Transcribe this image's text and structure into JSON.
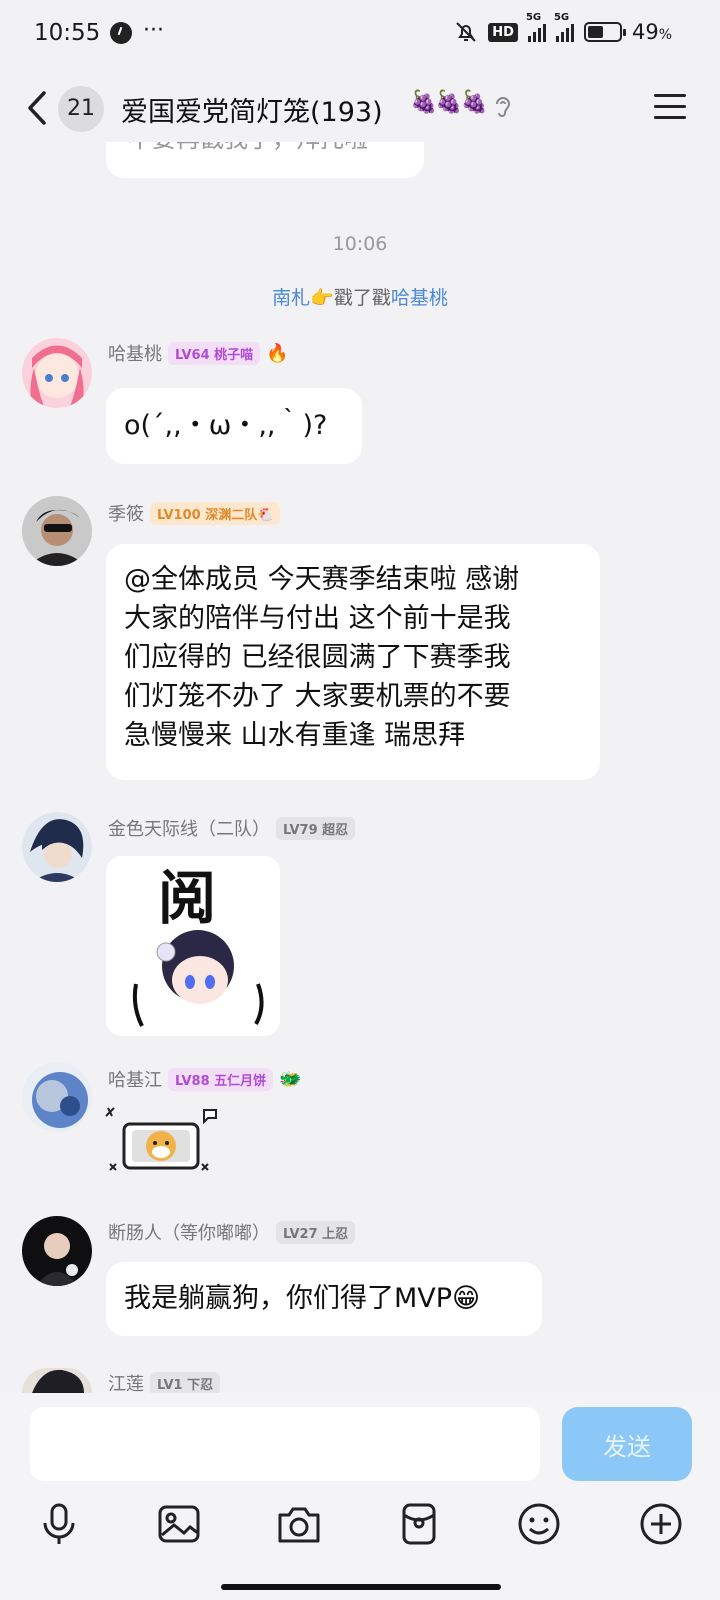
{
  "status_bar": {
    "time": "10:55",
    "dots": "···",
    "hd": "HD",
    "net1": "5G",
    "net2": "5G",
    "battery_pct": "49",
    "battery_unit": "%",
    "battery_level": 0.49
  },
  "header": {
    "unread_count": "21",
    "title": "爱国爱党简灯笼(193)",
    "title_deco": "🍇🍇🍇"
  },
  "chat": {
    "top_partial_text": "不要再戳我了，拜托啦",
    "time_divider": "10:06",
    "poke": {
      "actor": "南札",
      "emoji": "👉",
      "verb": "戳了戳",
      "target": "哈基桃"
    },
    "messages": [
      {
        "sender": "哈基桃",
        "level": "LV64 桃子喵",
        "sender_icon": "🔥",
        "text": "o(´,,・ω・,,｀)?"
      },
      {
        "sender": "季筱",
        "level": "LV100 深渊二队🐔",
        "lines": [
          "@全体成员 今天赛季结束啦 感谢",
          "大家的陪伴与付出 这个前十是我",
          "们应得的 已经很圆满了下赛季我",
          "们灯笼不办了 大家要机票的不要",
          "急慢慢来 山水有重逢 瑞思拜"
        ]
      },
      {
        "sender": "金色天际线（二队）",
        "level": "LV79 超忍",
        "sticker_text": "阅"
      },
      {
        "sender": "哈基江",
        "level": "LV88 五仁月饼",
        "sender_icon": "🐲",
        "sticker_text": "🐶"
      },
      {
        "sender": "断肠人（等你嘟嘟）",
        "level": "LV27 上忍",
        "text": "我是躺赢狗，你们得了MVP😁"
      },
      {
        "sender": "江莲",
        "level": "LV1 下忍"
      }
    ]
  },
  "input": {
    "placeholder": "",
    "send_label": "发送"
  },
  "toolbar": {
    "icons": [
      "microphone-icon",
      "image-icon",
      "camera-icon",
      "red-packet-icon",
      "emoji-icon",
      "plus-icon"
    ]
  }
}
